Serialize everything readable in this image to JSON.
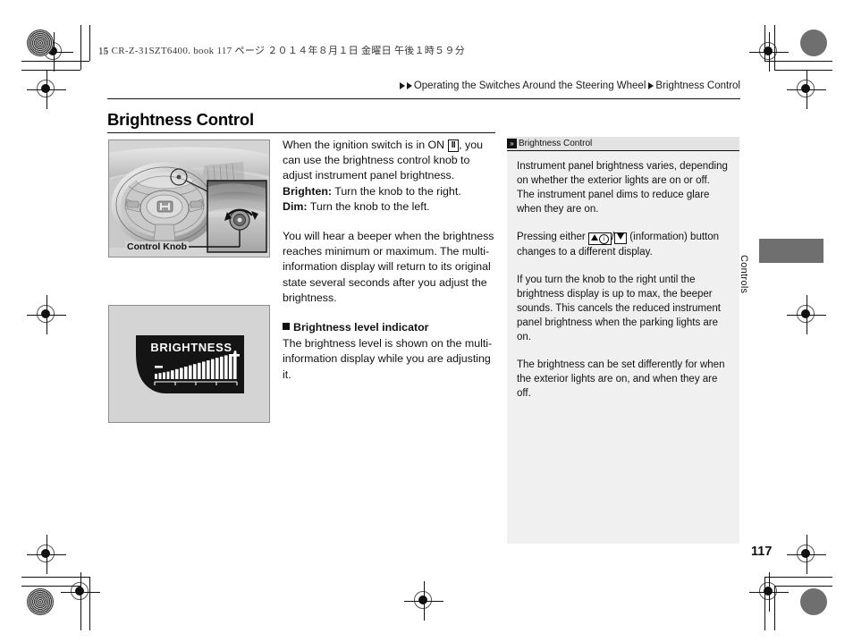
{
  "print": {
    "file_header": "15 CR-Z-31SZT6400. book   117 ページ   ２０１４年８月１日   金曜日   午後１時５９分",
    "corner_label": "15"
  },
  "breadcrumb": {
    "parent": "Operating the Switches Around the Steering Wheel",
    "current": "Brightness Control"
  },
  "page": {
    "title": "Brightness Control",
    "number": "117",
    "side_tab": "Controls"
  },
  "figures": {
    "steering": {
      "caption": "Control Knob",
      "alt": "Steering wheel with callout magnifier showing brightness control knob"
    },
    "brightness_display": {
      "label": "BRIGHTNESS",
      "minus": "–",
      "plus": "+",
      "alt": "Multi-information display showing brightness level bar gauge"
    }
  },
  "body": {
    "intro_part1": "When the ignition switch is in ON ",
    "ignition_icon": "II",
    "intro_part2": ", you can use the brightness control knob to adjust instrument panel brightness.",
    "brighten_label": "Brighten:",
    "brighten_text": " Turn the knob to the right.",
    "dim_label": "Dim:",
    "dim_text": " Turn the knob to the left.",
    "beeper_paragraph": "You will hear a beeper when the brightness reaches minimum or maximum. The multi-information display will return to its original state several seconds after you adjust the brightness.",
    "indicator_heading": "Brightness level indicator",
    "indicator_paragraph": "The brightness level is shown on the multi-information display while you are adjusting it."
  },
  "sidebar": {
    "header": "Brightness Control",
    "header_marker": "»",
    "paragraph1": "Instrument panel brightness varies, depending on whether the exterior lights are on or off. The instrument panel dims to reduce glare when they are on.",
    "press_part1": "Pressing either ",
    "press_part2": " (information) button changes to a different display.",
    "paragraph3": "If you turn the knob to the right until the brightness display is up to max, the beeper sounds. This cancels the reduced instrument panel brightness when the parking lights are on.",
    "paragraph4": "The brightness can be set differently for when the exterior lights are on, and when they are off."
  },
  "colors": {
    "figure_bg": "#d4d4d4",
    "sidebar_bg": "#f0f0f0",
    "sidebar_header_bg": "#e3e3e3",
    "tab_gray": "#6f6f6f",
    "display_black": "#141414"
  }
}
